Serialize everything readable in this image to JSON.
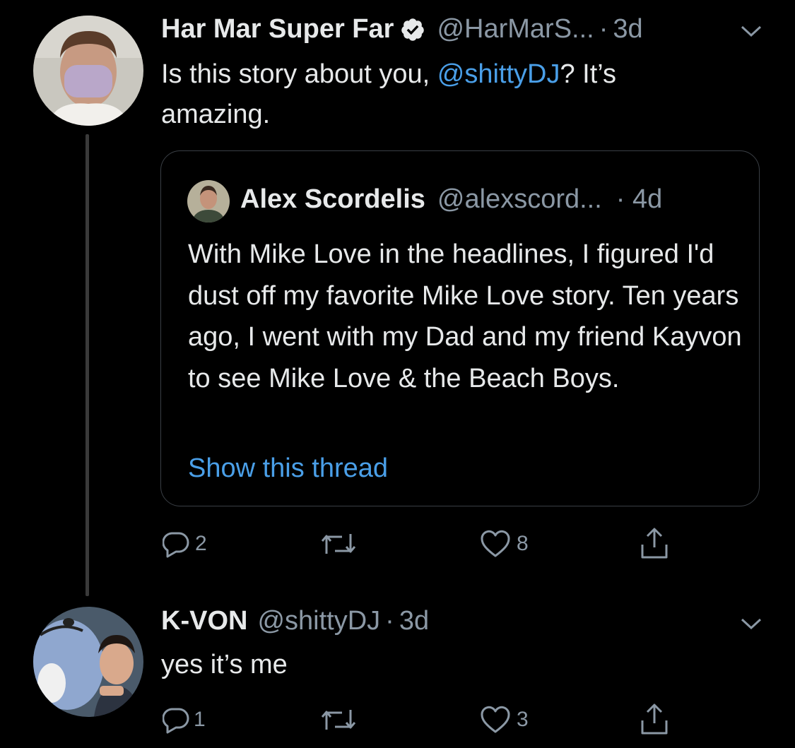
{
  "tweet1": {
    "display_name": "Har Mar Super Far",
    "handle": "@HarMarS...",
    "dot": "·",
    "time": "3d",
    "text_before": "Is this story about you, ",
    "mention": "@shittyDJ",
    "text_after": "? It’s amazing.",
    "quoted": {
      "display_name": "Alex Scordelis",
      "handle": "@alexscord...",
      "time": "· 4d",
      "text": "With Mike Love in the headlines, I figured I'd dust off my favorite Mike Love story. Ten years ago, I went with my Dad and my friend Kayvon to see Mike Love & the Beach Boys.",
      "show_thread": "Show this thread"
    },
    "actions": {
      "replies": "2",
      "likes": "8"
    }
  },
  "tweet2": {
    "display_name": "K-VON",
    "handle": "@shittyDJ",
    "dot": "·",
    "time": "3d",
    "text": "yes it’s me",
    "actions": {
      "replies": "1",
      "likes": "3"
    }
  },
  "icons": {
    "verified": "verified-badge-icon",
    "caret": "chevron-down-icon",
    "reply": "reply-icon",
    "retweet": "retweet-icon",
    "like": "heart-icon",
    "share": "share-icon"
  },
  "colors": {
    "background": "#000000",
    "link": "#4a9fe8",
    "muted": "#8b98a5",
    "text": "#e7e9ea"
  }
}
